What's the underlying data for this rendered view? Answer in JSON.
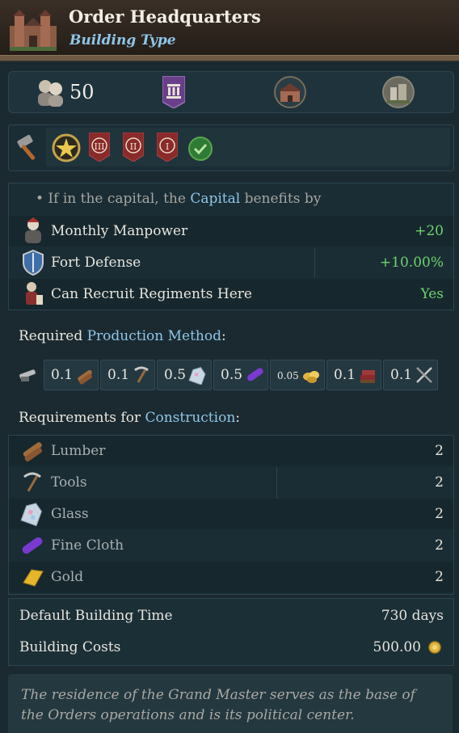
{
  "header": {
    "title": "Order Headquarters",
    "subtitle": "Building Type"
  },
  "summary": {
    "population": "50",
    "icons": [
      "population-icon",
      "parliament-icon",
      "building-icon",
      "castle-icon"
    ]
  },
  "tags": [
    "hammer-icon",
    "star-icon",
    "rank-III-icon",
    "rank-II-icon",
    "rank-I-icon",
    "check-icon"
  ],
  "tag_labels": {
    "r3": "III",
    "r2": "II",
    "r1": "I"
  },
  "capital": {
    "bullet_prefix": "• If in the capital, the ",
    "capital_link": "Capital",
    "bullet_suffix": " benefits by",
    "rows": [
      {
        "label": "Monthly Manpower",
        "value": "+20",
        "icon": "manpower-icon"
      },
      {
        "label": "Fort Defense",
        "value": "+10.00%",
        "icon": "shield-icon"
      },
      {
        "label": "Can Recruit Regiments Here",
        "value": "Yes",
        "icon": "regiment-icon"
      }
    ]
  },
  "production": {
    "title_prefix": "Required ",
    "title_link": "Production Method",
    "title_suffix": ":",
    "items": [
      {
        "value": "0.1",
        "icon": "lumber-icon"
      },
      {
        "value": "0.1",
        "icon": "tools-icon"
      },
      {
        "value": "0.5",
        "icon": "glass-icon"
      },
      {
        "value": "0.5",
        "icon": "fine-cloth-icon"
      },
      {
        "value": "0.05",
        "icon": "gold-icon"
      },
      {
        "value": "0.1",
        "icon": "books-icon"
      },
      {
        "value": "0.1",
        "icon": "weapons-icon"
      }
    ]
  },
  "construction": {
    "title_prefix": "Requirements for ",
    "title_link": "Construction",
    "title_suffix": ":",
    "items": [
      {
        "label": "Lumber",
        "value": "2",
        "icon": "lumber-icon"
      },
      {
        "label": "Tools",
        "value": "2",
        "icon": "tools-icon"
      },
      {
        "label": "Glass",
        "value": "2",
        "icon": "glass-icon"
      },
      {
        "label": "Fine Cloth",
        "value": "2",
        "icon": "fine-cloth-icon"
      },
      {
        "label": "Gold",
        "value": "2",
        "icon": "gold-icon"
      }
    ]
  },
  "stats": {
    "time_label": "Default Building Time",
    "time_value": "730 days",
    "cost_label": "Building Costs",
    "cost_value": "500.00"
  },
  "description": "The residence of the Grand Master serves as the base of the Orders operations and is its political center.",
  "colors": {
    "background": "#1b2a31",
    "accent_blue": "#8fc6e8",
    "positive_green": "#6ed36b"
  }
}
